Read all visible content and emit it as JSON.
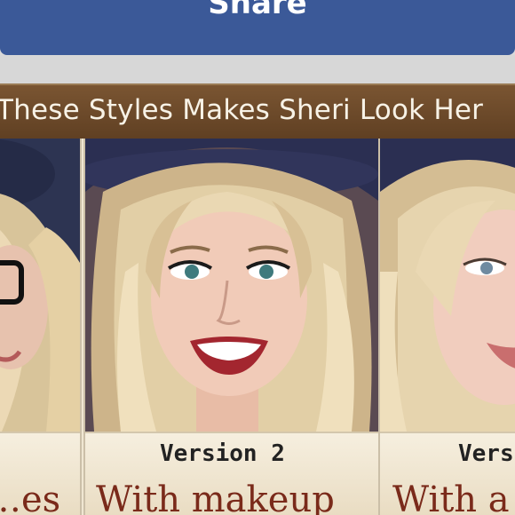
{
  "header": {
    "share_label": "Share"
  },
  "banner": {
    "text": "These Styles Makes Sheri Look Her"
  },
  "cards": [
    {
      "version": "",
      "style": "…es",
      "photo": "woman-with-glasses-photo"
    },
    {
      "version": "Version 2",
      "style": "With makeup",
      "photo": "woman-with-makeup-photo"
    },
    {
      "version": "Vers",
      "style": "With a",
      "photo": "woman-portrait-photo"
    }
  ],
  "colors": {
    "share_bar": "#3b5998",
    "banner": "#6b4a2b",
    "style_title": "#7a2a1a"
  }
}
